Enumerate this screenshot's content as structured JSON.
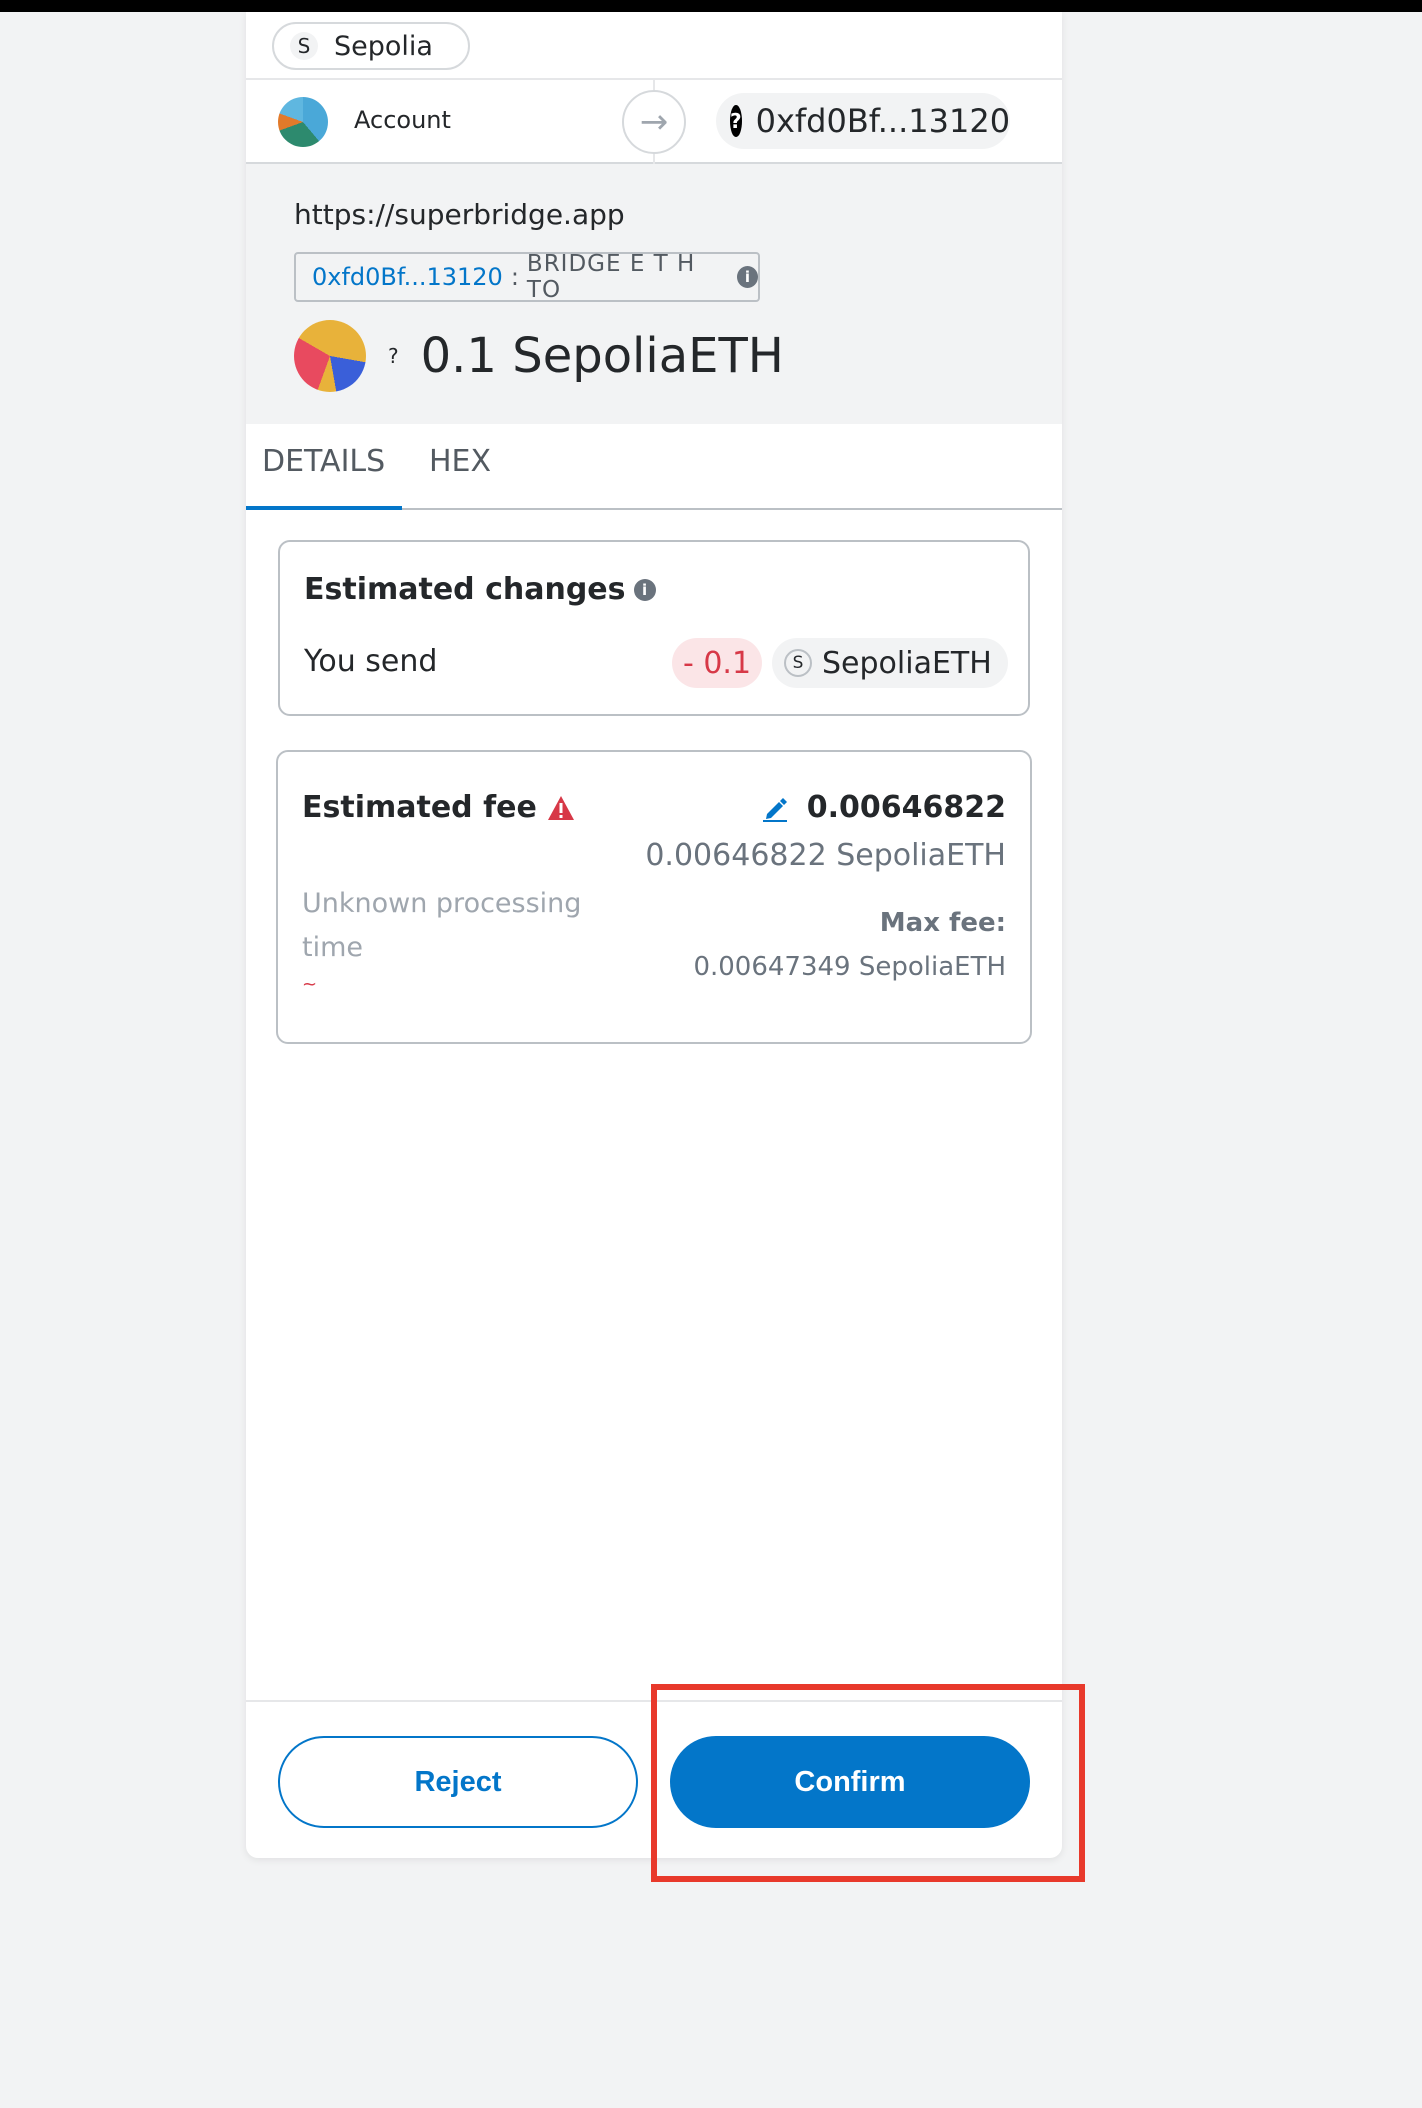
{
  "network": {
    "badge": "S",
    "name": "Sepolia"
  },
  "account": {
    "label": "Account",
    "recipient": "0xfd0Bf...13120",
    "recipient_icon": "?"
  },
  "origin": {
    "url": "https://superbridge.app",
    "method_address": "0xfd0Bf...13120",
    "method_sep": ":",
    "method_name": "BRIDGE E T H TO",
    "value_prefix": "?",
    "value_amount": "0.1 SepoliaETH"
  },
  "tabs": [
    {
      "label": "DETAILS",
      "active": true
    },
    {
      "label": "HEX",
      "active": false
    }
  ],
  "estimated_changes": {
    "title": "Estimated changes",
    "you_send_label": "You send",
    "amount": "- 0.1",
    "token_badge": "S",
    "token": "SepoliaETH"
  },
  "estimated_fee": {
    "title": "Estimated fee",
    "value": "0.00646822",
    "secondary": "0.00646822 SepoliaETH",
    "processing": "Unknown processing time",
    "tilde": "~",
    "max_fee_label": "Max fee:",
    "max_fee_value": "0.00647349 SepoliaETH"
  },
  "footer": {
    "reject": "Reject",
    "confirm": "Confirm"
  },
  "colors": {
    "primary": "#0376c9",
    "error": "#d73847",
    "highlight": "#e8392b"
  },
  "icons": {
    "info": "info-icon",
    "warning": "warning-icon",
    "edit": "edit-icon",
    "arrow": "arrow-right-icon"
  }
}
